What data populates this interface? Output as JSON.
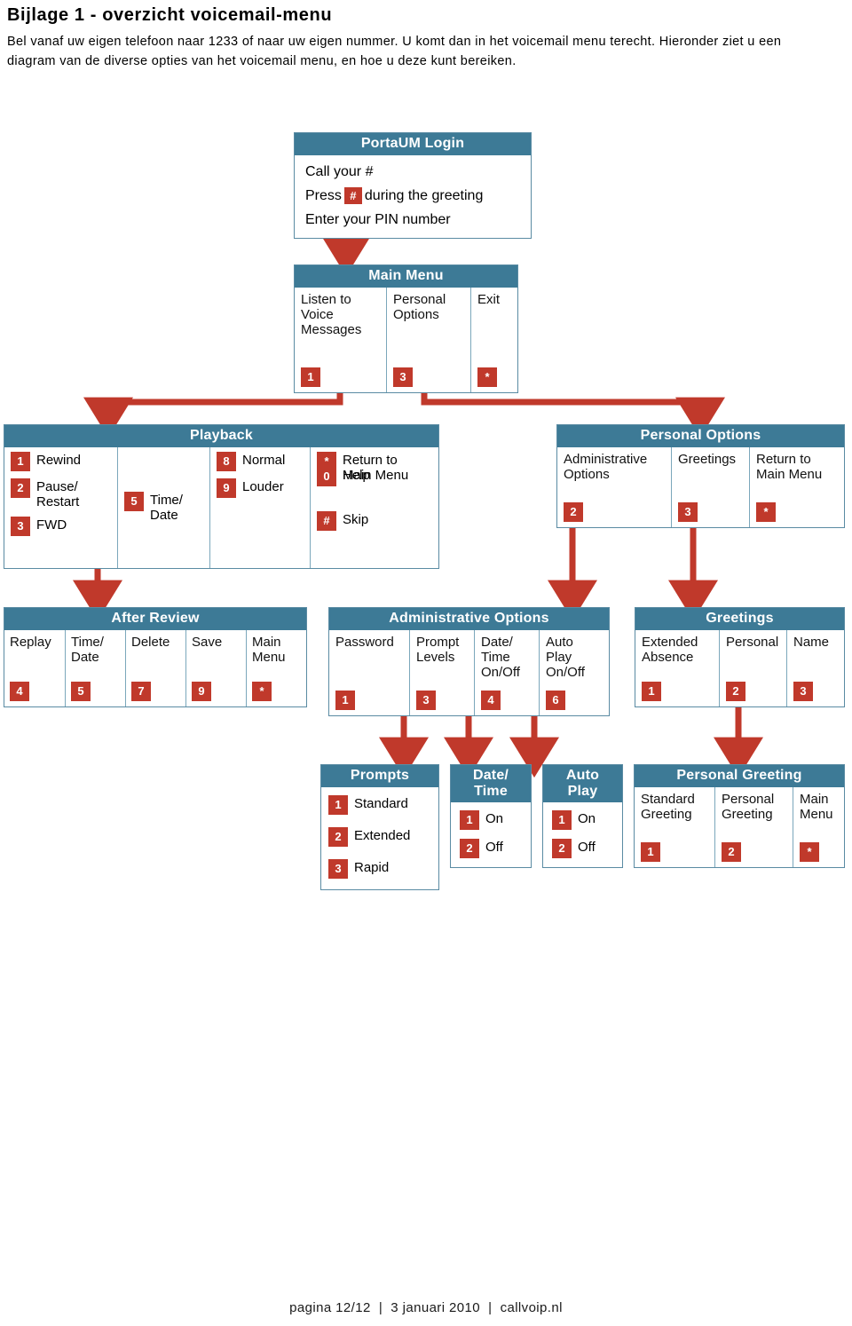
{
  "document": {
    "title": "Bijlage 1 - overzicht voicemail-menu",
    "intro": "Bel vanaf uw eigen telefoon naar 1233 of naar uw eigen nummer. U komt dan in het voicemail menu terecht. Hieronder ziet u een diagram van de diverse opties van het voicemail menu, en hoe u deze kunt bereiken."
  },
  "colors": {
    "header_blue": "#3d7a96",
    "key_red": "#c0392b",
    "arrow_red": "#c0392b",
    "box_border": "#5a8ba3"
  },
  "diagram": {
    "login": {
      "title": "PortaUM Login",
      "line1": "Call your #",
      "line2_pre": "Press",
      "line2_key": "#",
      "line2_post": "during the greeting",
      "line3": "Enter your PIN number"
    },
    "main_menu": {
      "title": "Main Menu",
      "columns": [
        {
          "label": "Listen to\nVoice\nMessages",
          "key": "1"
        },
        {
          "label": "Personal\nOptions",
          "key": "3"
        },
        {
          "label": "Exit",
          "key": "*"
        }
      ]
    },
    "playback": {
      "title": "Playback",
      "col1": [
        {
          "key": "1",
          "text": "Rewind"
        },
        {
          "key": "2",
          "text": "Pause/\nRestart"
        },
        {
          "key": "3",
          "text": "FWD"
        }
      ],
      "col2": [
        {
          "key": "5",
          "text": "Time/\nDate"
        }
      ],
      "col3": [
        {
          "key": "8",
          "text": "Normal"
        },
        {
          "key": "9",
          "text": "Louder"
        }
      ],
      "col4": [
        {
          "key": "*",
          "text": "Return to\nMain Menu"
        },
        {
          "key": "0",
          "text": "Help"
        },
        {
          "key": "#",
          "text": "Skip"
        }
      ]
    },
    "personal_options": {
      "title": "Personal Options",
      "columns": [
        {
          "label": "Administrative\nOptions",
          "key": "2"
        },
        {
          "label": "Greetings",
          "key": "3"
        },
        {
          "label": "Return to\nMain Menu",
          "key": "*"
        }
      ]
    },
    "after_review": {
      "title": "After Review",
      "columns": [
        {
          "label": "Replay",
          "key": "4"
        },
        {
          "label": "Time/\nDate",
          "key": "5"
        },
        {
          "label": "Delete",
          "key": "7"
        },
        {
          "label": "Save",
          "key": "9"
        },
        {
          "label": "Main\nMenu",
          "key": "*"
        }
      ]
    },
    "admin_options": {
      "title": "Administrative Options",
      "columns": [
        {
          "label": "Password",
          "key": "1"
        },
        {
          "label": "Prompt\nLevels",
          "key": "3"
        },
        {
          "label": "Date/\nTime\nOn/Off",
          "key": "4"
        },
        {
          "label": "Auto\nPlay\nOn/Off",
          "key": "6"
        }
      ]
    },
    "greetings": {
      "title": "Greetings",
      "columns": [
        {
          "label": "Extended\nAbsence",
          "key": "1"
        },
        {
          "label": "Personal",
          "key": "2"
        },
        {
          "label": "Name",
          "key": "3"
        }
      ]
    },
    "prompts": {
      "title": "Prompts",
      "rows": [
        {
          "key": "1",
          "text": "Standard"
        },
        {
          "key": "2",
          "text": "Extended"
        },
        {
          "key": "3",
          "text": "Rapid"
        }
      ]
    },
    "date_time": {
      "title": "Date/\nTime",
      "rows": [
        {
          "key": "1",
          "text": "On"
        },
        {
          "key": "2",
          "text": "Off"
        }
      ]
    },
    "auto_play": {
      "title": "Auto\nPlay",
      "rows": [
        {
          "key": "1",
          "text": "On"
        },
        {
          "key": "2",
          "text": "Off"
        }
      ]
    },
    "personal_greeting": {
      "title": "Personal Greeting",
      "columns": [
        {
          "label": "Standard\nGreeting",
          "key": "1"
        },
        {
          "label": "Personal\nGreeting",
          "key": "2"
        },
        {
          "label": "Main\nMenu",
          "key": "*"
        }
      ]
    }
  },
  "footer": {
    "page": "pagina 12/12",
    "sep1": "  |  ",
    "date": "3 januari 2010",
    "sep2": "  |  ",
    "site": "callvoip.nl"
  }
}
